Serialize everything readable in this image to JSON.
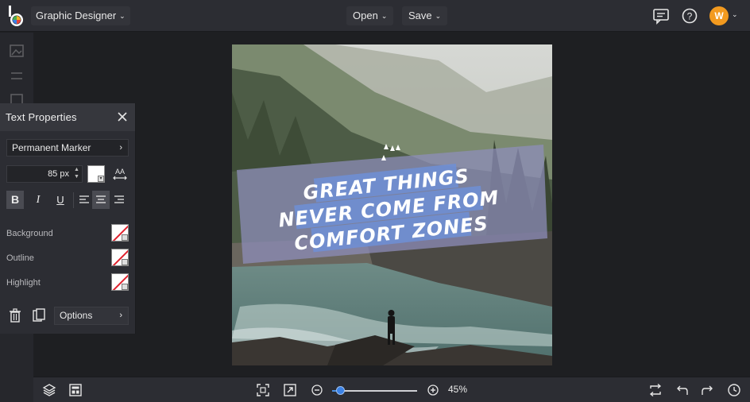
{
  "header": {
    "app_name": "Graphic Designer",
    "open_label": "Open",
    "save_label": "Save",
    "user_initial": "W"
  },
  "text_panel": {
    "title": "Text Properties",
    "font_family": "Permanent Marker",
    "font_size": "85",
    "font_unit": "px",
    "text_color": "#ffffff",
    "background_label": "Background",
    "outline_label": "Outline",
    "highlight_label": "Highlight",
    "options_label": "Options"
  },
  "canvas": {
    "quote_lines": [
      "Great things",
      "never come from",
      "comfort zones"
    ]
  },
  "zoom": {
    "level_label": "45%",
    "level": 0.1
  },
  "colors": {
    "accent": "#3b82e6",
    "avatar": "#f39a1f",
    "highlight_none": "#e0212d"
  }
}
